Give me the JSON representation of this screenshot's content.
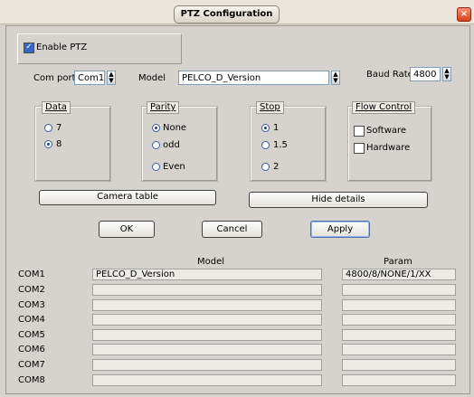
{
  "window": {
    "title": "PTZ Configuration",
    "close_glyph": "×"
  },
  "enable": {
    "label": "Enable PTZ",
    "checked": true
  },
  "settings": {
    "com_port_label": "Com port",
    "com_port_value": "Com1",
    "model_label": "Model",
    "model_value": "PELCO_D_Version",
    "baud_label": "Baud Rate",
    "baud_value": "4800"
  },
  "data_group": {
    "legend": "Data",
    "options": [
      "7",
      "8"
    ],
    "selected": "8"
  },
  "parity_group": {
    "legend": "Parity",
    "options": [
      "None",
      "odd",
      "Even"
    ],
    "selected": "None"
  },
  "stop_group": {
    "legend": "Stop",
    "options": [
      "1",
      "1.5",
      "2"
    ],
    "selected": "1"
  },
  "flow_group": {
    "legend": "Flow Control",
    "options": [
      "Software",
      "Hardware"
    ]
  },
  "buttons": {
    "camera_table": "Camera table",
    "hide_details": "Hide details",
    "ok": "OK",
    "cancel": "Cancel",
    "apply": "Apply"
  },
  "table": {
    "model_header": "Model",
    "param_header": "Param",
    "rows": [
      {
        "port": "COM1",
        "model": "PELCO_D_Version",
        "param": "4800/8/NONE/1/XX"
      },
      {
        "port": "COM2",
        "model": "",
        "param": ""
      },
      {
        "port": "COM3",
        "model": "",
        "param": ""
      },
      {
        "port": "COM4",
        "model": "",
        "param": ""
      },
      {
        "port": "COM5",
        "model": "",
        "param": ""
      },
      {
        "port": "COM6",
        "model": "",
        "param": ""
      },
      {
        "port": "COM7",
        "model": "",
        "param": ""
      },
      {
        "port": "COM8",
        "model": "",
        "param": ""
      }
    ]
  },
  "icons": {
    "spin": "up-down-arrows-icon",
    "check": "checkmark-icon"
  }
}
